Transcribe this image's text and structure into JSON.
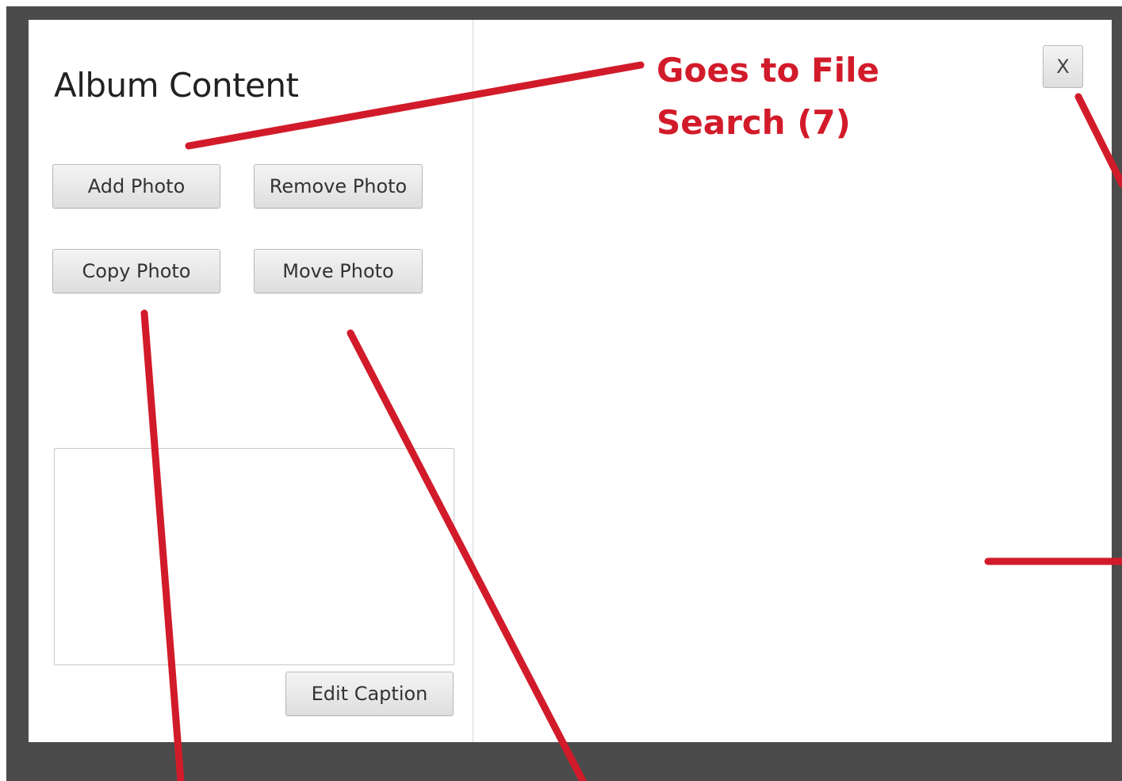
{
  "panel": {
    "title": "Album Content"
  },
  "buttons": {
    "add_photo": "Add Photo",
    "remove_photo": "Remove Photo",
    "copy_photo": "Copy Photo",
    "move_photo": "Move Photo",
    "edit_caption": "Edit Caption",
    "close": "X"
  },
  "caption": {
    "value": ""
  },
  "annotation": {
    "line1": "Goes to File",
    "line2": "Search (7)",
    "color": "#d21b2a"
  },
  "colors": {
    "frame": "#4b4b4b",
    "window": "#ffffff"
  }
}
